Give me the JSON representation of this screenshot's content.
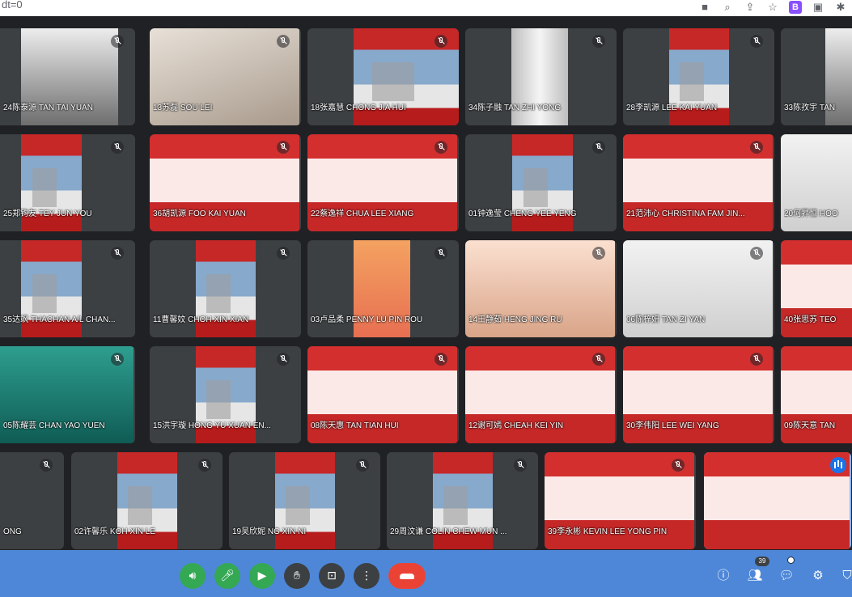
{
  "browser": {
    "url_fragment": "dt=0"
  },
  "colors": {
    "background": "#202124",
    "tile": "#3c4043",
    "controls_bar": "#4e87d8",
    "mic_on": "#34a853",
    "end_call": "#ea4335",
    "speaking": "#1a73e8"
  },
  "participants": [
    {
      "name": "24陈泰源 TAN TAI YUAN",
      "bg": "ceiling"
    },
    {
      "name": "13苏磊 SOU LEI",
      "bg": "room"
    },
    {
      "name": "18张嘉慧 CHONG JIA HUI",
      "bg": "poster"
    },
    {
      "name": "34陈子融 TAN ZHI YONG",
      "bg": "curtain"
    },
    {
      "name": "28李凯源 LEE KAI YUAN",
      "bg": "poster"
    },
    {
      "name": "33陈孜宇 TAN",
      "bg": "ceiling"
    },
    {
      "name": "25郑钧友 TEY JUN YOU",
      "bg": "poster"
    },
    {
      "name": "36胡凯源 FOO KAI YUAN",
      "bg": "banner"
    },
    {
      "name": "22蔡逸祥 CHUA LEE XIANG",
      "bg": "banner"
    },
    {
      "name": "01钟逸莹 CHENG YEE YENG",
      "bg": "poster"
    },
    {
      "name": "21范沛心 CHRISTINA FAM JIN...",
      "bg": "banner"
    },
    {
      "name": "20何昇恒 HOO",
      "bg": "wall"
    },
    {
      "name": "35达飒 THACHAN A/L CHAN...",
      "bg": "poster"
    },
    {
      "name": "11曹馨妏 CHOH XIN XIAN",
      "bg": "poster"
    },
    {
      "name": "03卢品柔 PENNY LU PIN ROU",
      "bg": "paper"
    },
    {
      "name": "14王静茹 HENG JING RU",
      "bg": "face"
    },
    {
      "name": "06陈梓妍 TAN ZI YAN",
      "bg": "wall"
    },
    {
      "name": "40张思苏 TEO",
      "bg": "banner"
    },
    {
      "name": "05陈耀芸 CHAN YAO YUEN",
      "bg": "teal"
    },
    {
      "name": "15洪宇璇 HONG YU XUAN EN...",
      "bg": "poster"
    },
    {
      "name": "08陈天惠 TAN TIAN HUI",
      "bg": "banner"
    },
    {
      "name": "12谢可嫣 CHEAH KEI YIN",
      "bg": "banner"
    },
    {
      "name": "30李伟阳 LEE WEI YANG",
      "bg": "banner"
    },
    {
      "name": "09陈天意 TAN",
      "bg": "banner"
    },
    {
      "name": "ONG",
      "bg": "poster"
    },
    {
      "name": "02许馨乐 KOH XIN LE",
      "bg": "poster"
    },
    {
      "name": "19吴欣妮 NG XIN NI",
      "bg": "poster"
    },
    {
      "name": "29周汶谦 COLIN CHEW MUN ...",
      "bg": "poster"
    },
    {
      "name": "39李永彬 KEVIN LEE YONG PIN",
      "bg": "banner"
    },
    {
      "name": "",
      "bg": "banner"
    }
  ],
  "controls": {
    "people_count": "39"
  },
  "icons": {
    "volume": "volume-icon",
    "mic": "microphone-icon",
    "camera": "camera-icon",
    "hand": "raise-hand-icon",
    "present": "present-screen-icon",
    "more": "more-options-icon",
    "end": "end-call-icon",
    "info": "info-icon",
    "people": "people-icon",
    "chat": "chat-icon",
    "activities": "activities-icon",
    "safety": "host-controls-icon"
  }
}
